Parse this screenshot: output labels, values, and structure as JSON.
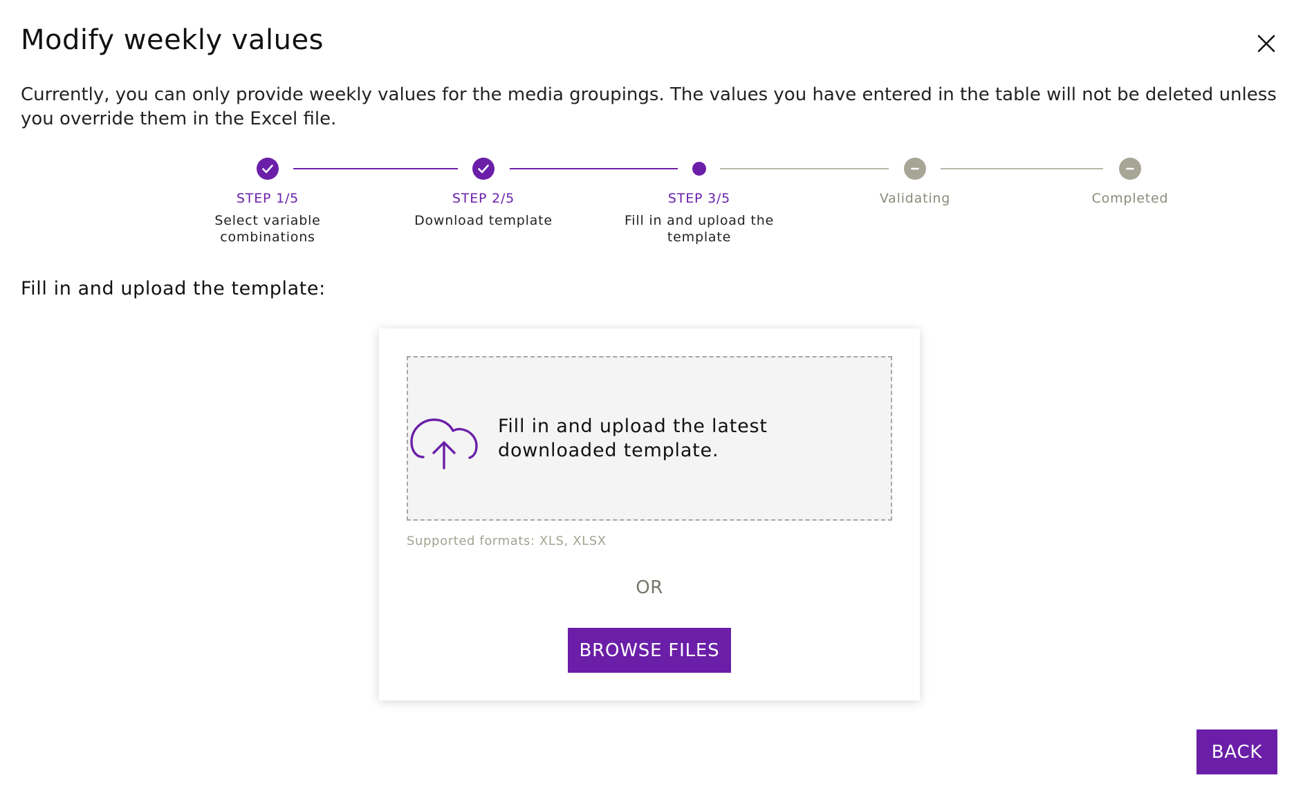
{
  "dialog": {
    "title": "Modify weekly values",
    "description": "Currently, you can only provide weekly values for the media groupings. The values you have entered in the table will not be deleted unless you override them in the Excel file."
  },
  "stepper": {
    "steps": [
      {
        "label": "STEP 1/5",
        "description": "Select variable combinations",
        "status": "completed"
      },
      {
        "label": "STEP 2/5",
        "description": "Download template",
        "status": "completed"
      },
      {
        "label": "STEP 3/5",
        "description": "Fill in and upload the template",
        "status": "current"
      },
      {
        "label": "Validating",
        "description": "",
        "status": "pending"
      },
      {
        "label": "Completed",
        "description": "",
        "status": "pending"
      }
    ]
  },
  "upload": {
    "heading": "Fill in and upload the template:",
    "dropzone_text": "Fill in and upload the latest downloaded template.",
    "dropzone_icon": "cloud-upload-icon",
    "formats": "Supported formats: XLS, XLSX",
    "or_text": "OR",
    "browse_label": "BROWSE FILES"
  },
  "footer": {
    "back_label": "BACK"
  },
  "colors": {
    "accent": "#6b1fa8",
    "pending": "#a7a696",
    "dropzone_bg": "#f4f4f4"
  }
}
